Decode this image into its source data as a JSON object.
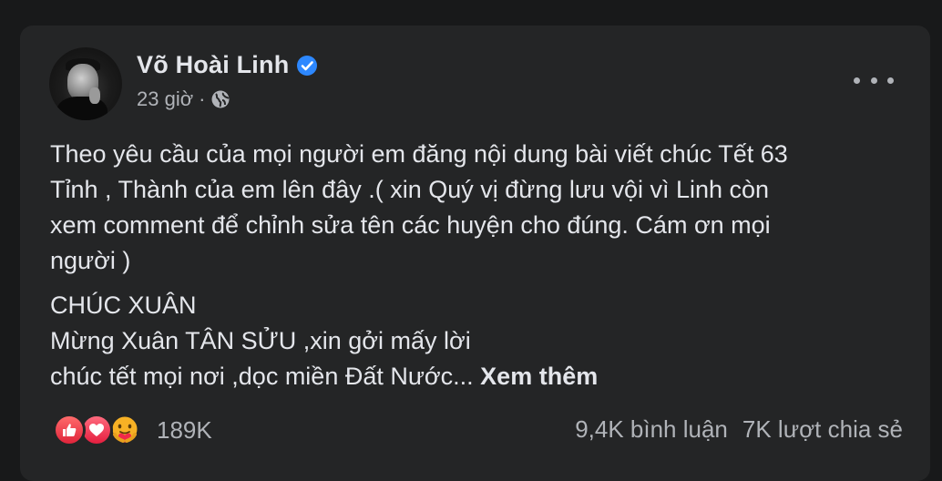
{
  "post": {
    "author": "Võ Hoài Linh",
    "time": "23 giờ",
    "separator": "·",
    "paragraph1": [
      "Theo yêu cầu của mọi người em đăng nội dung bài viết chúc Tết 63",
      "Tỉnh , Thành của em lên đây .( xin Quý vị đừng lưu vội vì Linh còn",
      "xem comment để chỉnh sửa tên các huyện cho đúng. Cám ơn mọi",
      "người )"
    ],
    "paragraph2": [
      "CHÚC XUÂN",
      "Mừng Xuân TÂN SỬU ,xin gởi mấy lời",
      "chúc tết mọi nơi ,dọc miền Đất Nước..."
    ],
    "see_more": "Xem thêm",
    "reaction_count": "189K",
    "comments": "9,4K bình luận",
    "shares": "7K lượt chia sẻ"
  },
  "icons": {
    "verified": "verified-badge-icon",
    "audience": "globe-icon",
    "more": "more-options-icon",
    "reactions": [
      "like-icon",
      "love-icon",
      "care-icon"
    ]
  },
  "colors": {
    "background": "#18191a",
    "card": "#242526",
    "primary_text": "#e4e6eb",
    "secondary_text": "#b0b3b8",
    "verified": "#2d88ff"
  }
}
